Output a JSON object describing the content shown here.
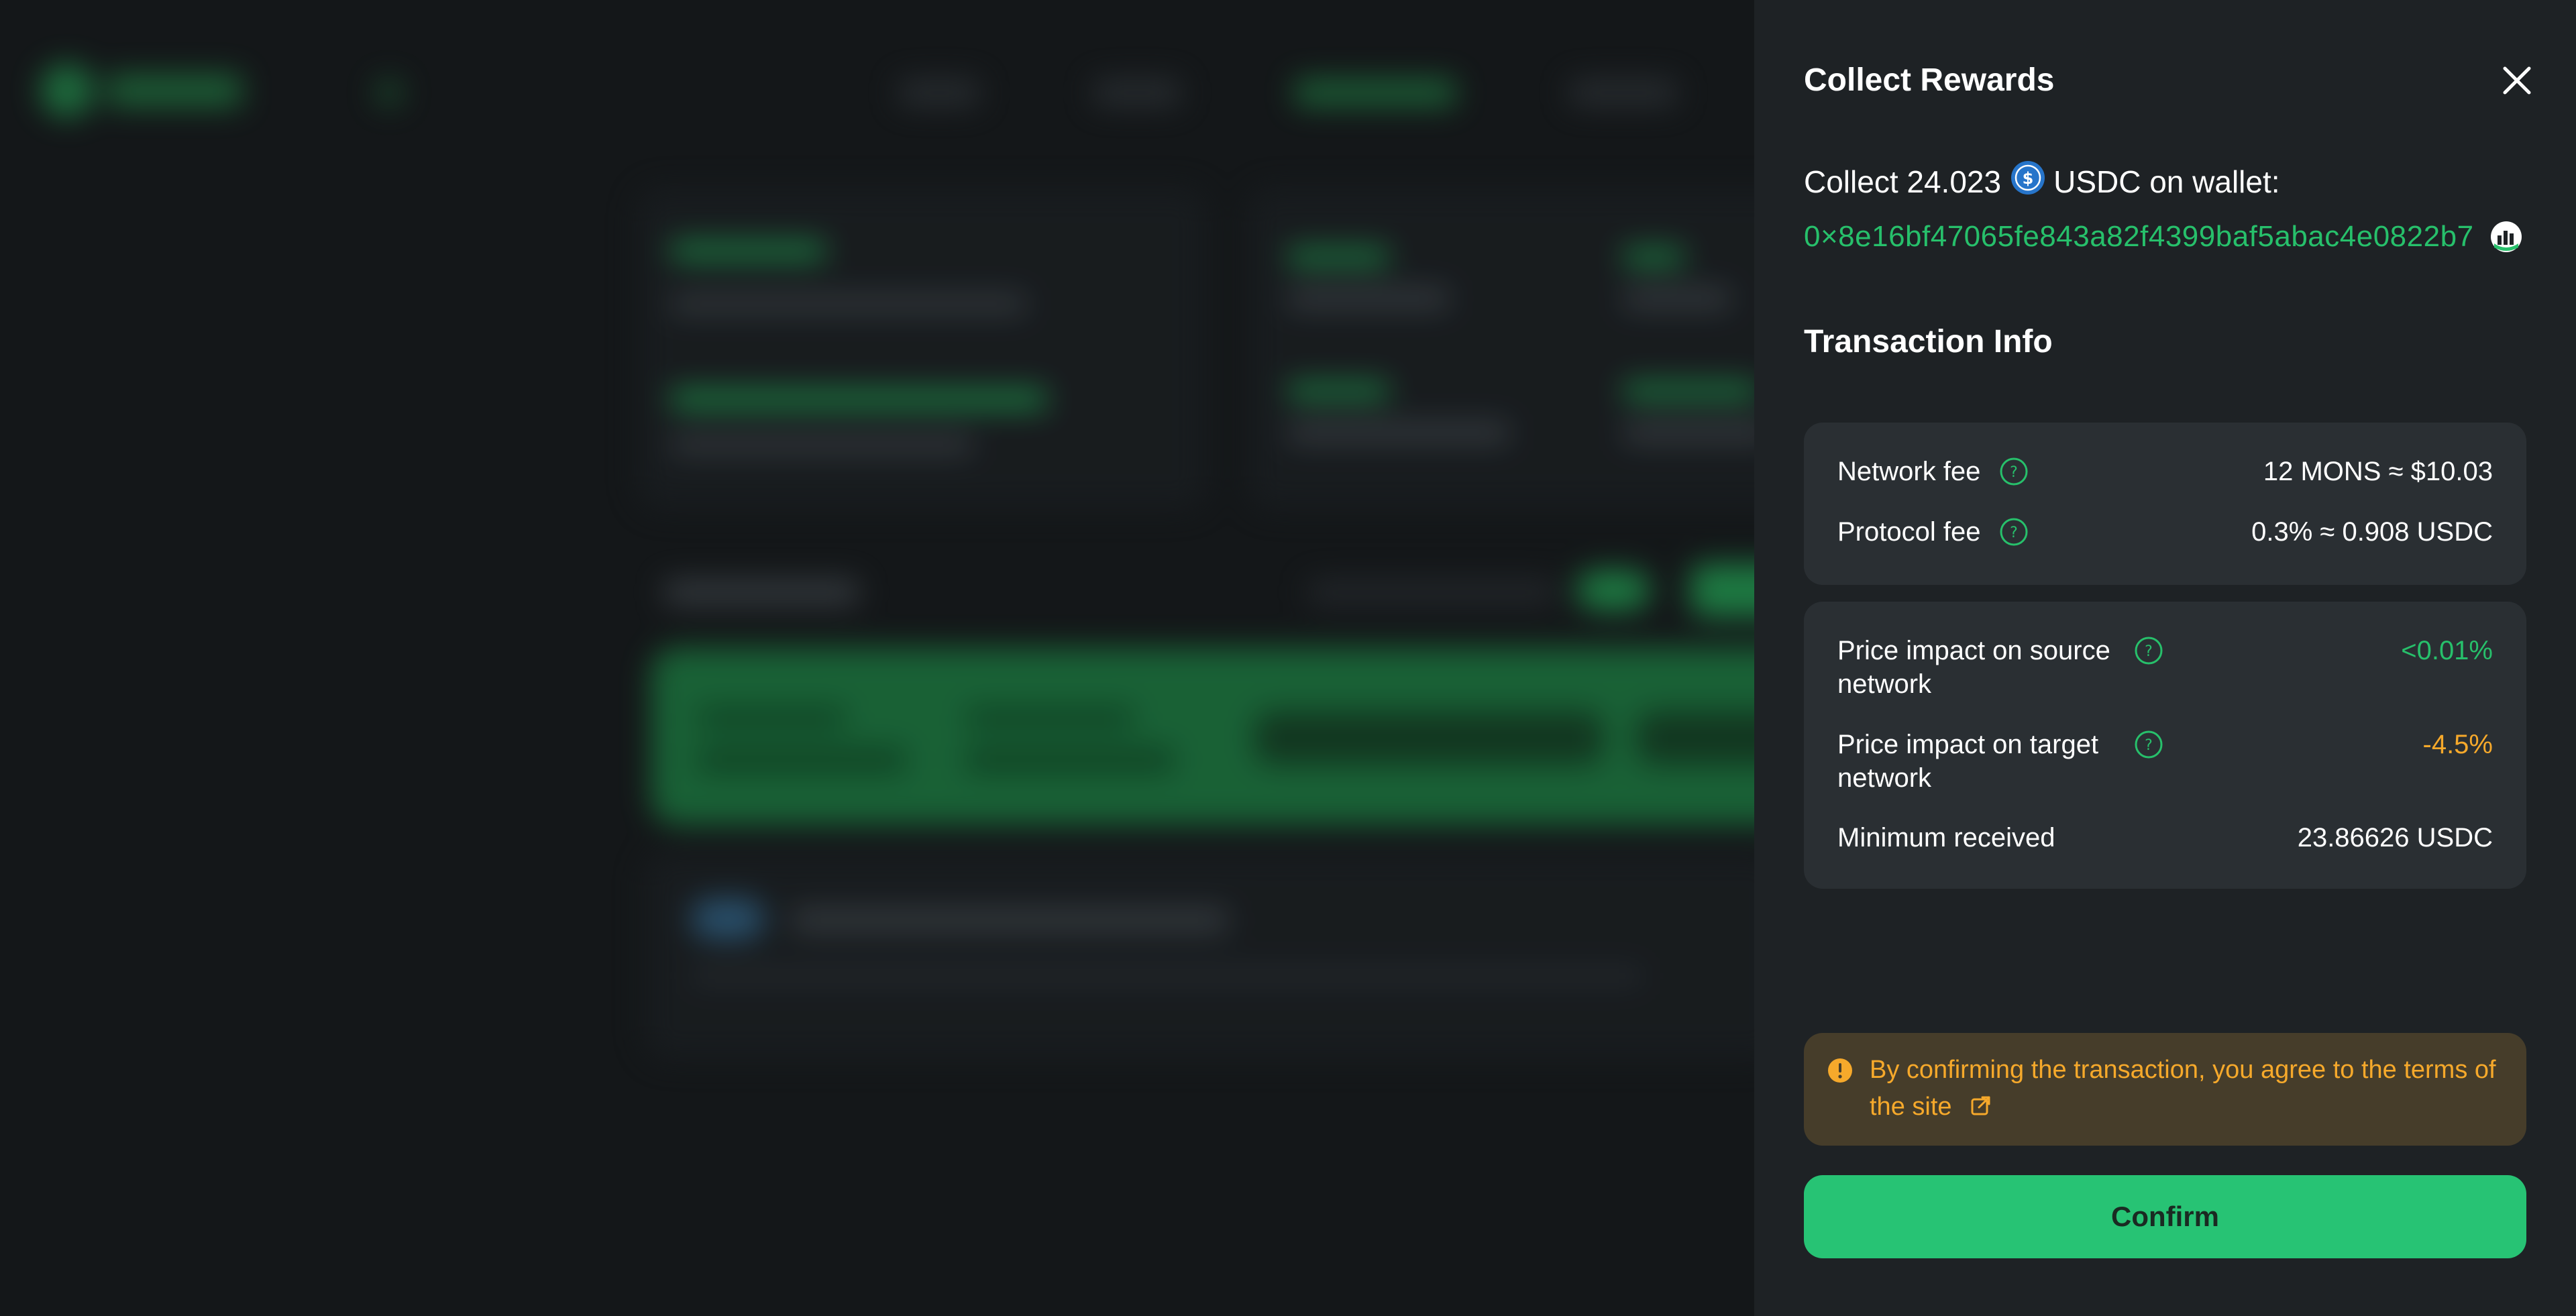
{
  "panel": {
    "title": "Collect Rewards",
    "collect_prefix": "Collect 24.023",
    "collect_token": "USDC on wallet:",
    "token_icon": "usdc-icon",
    "wallet_address": "0×8e16bf47065fe843a82f4399baf5abac4e0822b7",
    "wallet_icon": "wallet-avatar-icon",
    "close_icon": "close-icon"
  },
  "transaction": {
    "title": "Transaction Info",
    "fees": [
      {
        "label": "Network fee",
        "value": "12 MONS ≈ $10.03"
      },
      {
        "label": "Protocol fee",
        "value": "0.3% ≈ 0.908 USDC"
      }
    ],
    "impact": {
      "source_label": "Price impact on source network",
      "source_value": "<0.01%",
      "target_label": "Price impact on target network",
      "target_value": "-4.5%",
      "min_label": "Minimum received",
      "min_value": "23.86626 USDC"
    }
  },
  "notice": {
    "text": "By confirming the transaction, you agree to the terms of the site",
    "icon": "warning-icon",
    "link_icon": "external-link-icon"
  },
  "confirm_label": "Confirm",
  "colors": {
    "accent_green": "#27c06b",
    "warning_orange": "#f6a92b",
    "panel_bg": "#1e2225",
    "box_bg": "#2a2f33"
  }
}
